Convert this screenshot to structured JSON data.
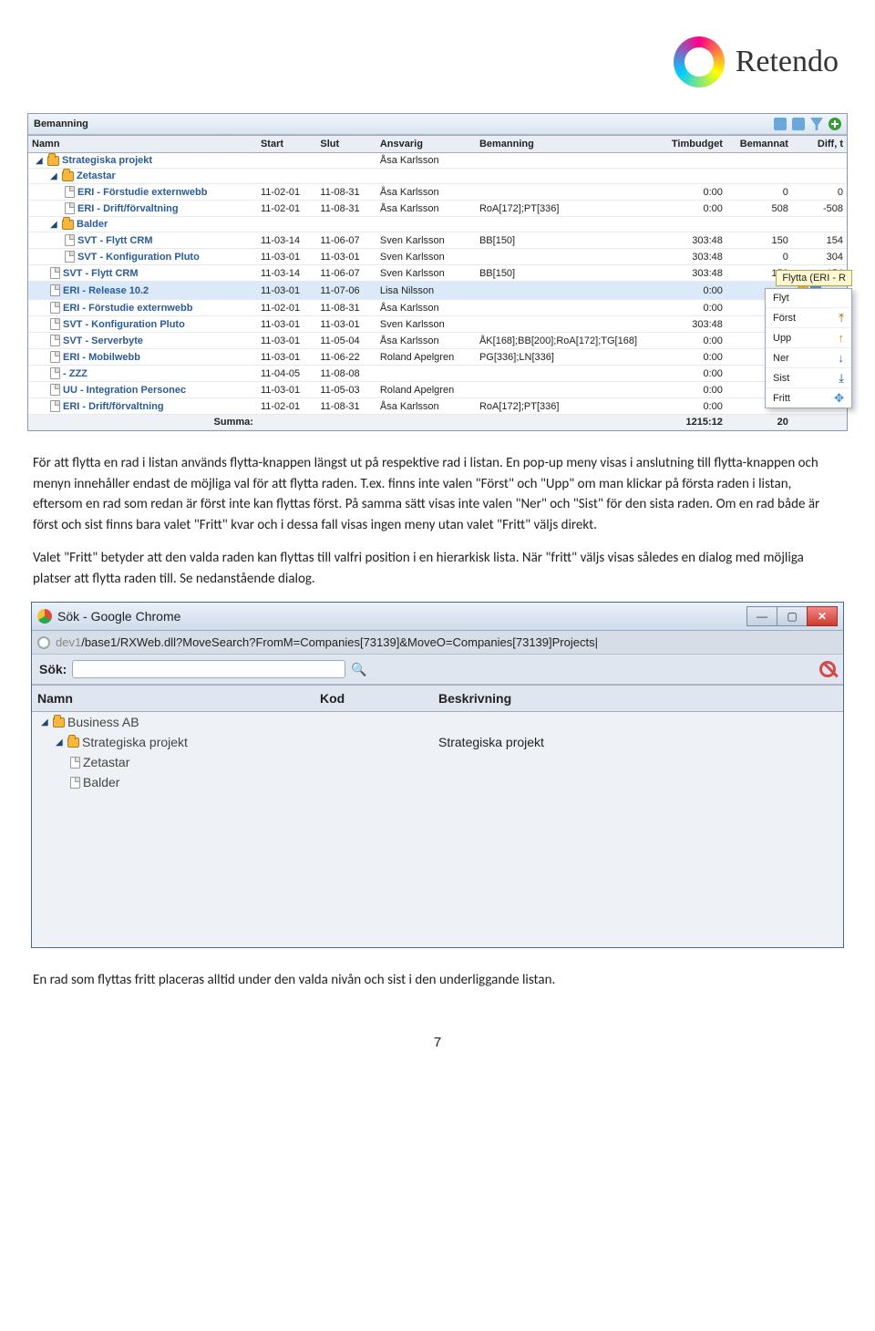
{
  "brand": "Retendo",
  "panel": {
    "title": "Bemanning",
    "headers": [
      "Namn",
      "Start",
      "Slut",
      "Ansvarig",
      "Bemanning",
      "Timbudget",
      "Bemannat",
      "Diff, t"
    ],
    "summa_label": "Summa:"
  },
  "rows": [
    {
      "depth": 0,
      "exp": true,
      "icon": "folder",
      "name": "Strategiska projekt",
      "start": "",
      "slut": "",
      "ansvarig": "Åsa Karlsson",
      "bem": "",
      "bud": "",
      "man": "",
      "diff": "",
      "selected": false
    },
    {
      "depth": 1,
      "exp": true,
      "icon": "folder",
      "name": "Zetastar",
      "start": "",
      "slut": "",
      "ansvarig": "",
      "bem": "",
      "bud": "",
      "man": "",
      "diff": "",
      "selected": false
    },
    {
      "depth": 2,
      "exp": false,
      "icon": "doc",
      "name": "ERI - Förstudie externwebb",
      "start": "11-02-01",
      "slut": "11-08-31",
      "ansvarig": "Åsa Karlsson",
      "bem": "",
      "bud": "0:00",
      "man": "0",
      "diff": "0",
      "selected": false
    },
    {
      "depth": 2,
      "exp": false,
      "icon": "doc",
      "name": "ERI - Drift/förvaltning",
      "start": "11-02-01",
      "slut": "11-08-31",
      "ansvarig": "Åsa Karlsson",
      "bem": "RoA[172];PT[336]",
      "bud": "0:00",
      "man": "508",
      "diff": "-508",
      "selected": false
    },
    {
      "depth": 1,
      "exp": true,
      "icon": "folder",
      "name": "Balder",
      "start": "",
      "slut": "",
      "ansvarig": "",
      "bem": "",
      "bud": "",
      "man": "",
      "diff": "",
      "selected": false
    },
    {
      "depth": 2,
      "exp": false,
      "icon": "doc",
      "name": "SVT - Flytt CRM",
      "start": "11-03-14",
      "slut": "11-06-07",
      "ansvarig": "Sven Karlsson",
      "bem": "BB[150]",
      "bud": "303:48",
      "man": "150",
      "diff": "154",
      "selected": false
    },
    {
      "depth": 2,
      "exp": false,
      "icon": "doc",
      "name": "SVT - Konfiguration Pluto",
      "start": "11-03-01",
      "slut": "11-03-01",
      "ansvarig": "Sven Karlsson",
      "bem": "",
      "bud": "303:48",
      "man": "0",
      "diff": "304",
      "selected": false
    },
    {
      "depth": 1,
      "exp": false,
      "icon": "doc",
      "name": "SVT - Flytt CRM",
      "start": "11-03-14",
      "slut": "11-06-07",
      "ansvarig": "Sven Karlsson",
      "bem": "BB[150]",
      "bud": "303:48",
      "man": "150",
      "diff": "154",
      "selected": false
    },
    {
      "depth": 1,
      "exp": false,
      "icon": "doc",
      "name": "ERI - Release 10.2",
      "start": "11-03-01",
      "slut": "11-07-06",
      "ansvarig": "Lisa Nilsson",
      "bem": "",
      "bud": "0:00",
      "man": "",
      "diff": "",
      "selected": true
    },
    {
      "depth": 1,
      "exp": false,
      "icon": "doc",
      "name": "ERI - Förstudie externwebb",
      "start": "11-02-01",
      "slut": "11-08-31",
      "ansvarig": "Åsa Karlsson",
      "bem": "",
      "bud": "0:00",
      "man": "",
      "diff": "",
      "selected": false
    },
    {
      "depth": 1,
      "exp": false,
      "icon": "doc",
      "name": "SVT - Konfiguration Pluto",
      "start": "11-03-01",
      "slut": "11-03-01",
      "ansvarig": "Sven Karlsson",
      "bem": "",
      "bud": "303:48",
      "man": "",
      "diff": "",
      "selected": false
    },
    {
      "depth": 1,
      "exp": false,
      "icon": "doc",
      "name": "SVT - Serverbyte",
      "start": "11-03-01",
      "slut": "11-05-04",
      "ansvarig": "Åsa Karlsson",
      "bem": "ÅK[168];BB[200];RoA[172];TG[168]",
      "bud": "0:00",
      "man": "",
      "diff": "",
      "selected": false
    },
    {
      "depth": 1,
      "exp": false,
      "icon": "doc",
      "name": "ERI - Mobilwebb",
      "start": "11-03-01",
      "slut": "11-06-22",
      "ansvarig": "Roland Apelgren",
      "bem": "PG[336];LN[336]",
      "bud": "0:00",
      "man": "",
      "diff": "",
      "selected": false
    },
    {
      "depth": 1,
      "exp": false,
      "icon": "doc",
      "name": "- ZZZ",
      "start": "11-04-05",
      "slut": "11-08-08",
      "ansvarig": "",
      "bem": "",
      "bud": "0:00",
      "man": "",
      "diff": "",
      "selected": false
    },
    {
      "depth": 1,
      "exp": false,
      "icon": "doc",
      "name": "UU - Integration Personec",
      "start": "11-03-01",
      "slut": "11-05-03",
      "ansvarig": "Roland Apelgren",
      "bem": "",
      "bud": "0:00",
      "man": "",
      "diff": "",
      "selected": false
    },
    {
      "depth": 1,
      "exp": false,
      "icon": "doc",
      "name": "ERI - Drift/förvaltning",
      "start": "11-02-01",
      "slut": "11-08-31",
      "ansvarig": "Åsa Karlsson",
      "bem": "RoA[172];PT[336]",
      "bud": "0:00",
      "man": "",
      "diff": "",
      "selected": false
    }
  ],
  "summa": {
    "bud": "1215:12",
    "man": "20"
  },
  "popup": {
    "tooltip": "Flytta (ERI - R",
    "items": [
      {
        "label": "Flyt",
        "arrow": "",
        "cls": ""
      },
      {
        "label": "Först",
        "arrow": "⤒",
        "cls": "arr-top"
      },
      {
        "label": "Upp",
        "arrow": "↑",
        "cls": "arr-up"
      },
      {
        "label": "Ner",
        "arrow": "↓",
        "cls": "arr-down"
      },
      {
        "label": "Sist",
        "arrow": "⤓",
        "cls": "arr-bot"
      },
      {
        "label": "Fritt",
        "arrow": "✥",
        "cls": "arr-free"
      }
    ]
  },
  "prose": {
    "p1": "För att flytta en rad i listan används flytta-knappen längst ut på respektive rad i listan. En pop-up meny visas i anslutning till flytta-knappen och menyn innehåller endast de möjliga val för att flytta raden. T.ex. finns inte valen \"Först\" och \"Upp\" om man klickar på första raden i listan, eftersom en rad som redan är först inte kan flyttas först. På samma sätt visas inte valen \"Ner\" och \"Sist\" för den sista raden. Om en rad både är först och sist finns bara valet \"Fritt\" kvar och i dessa fall visas ingen meny utan valet \"Fritt\" väljs direkt.",
    "p2": "Valet \"Fritt\" betyder att den valda raden kan flyttas till valfri position i en hierarkisk lista. När \"fritt\" väljs visas således en dialog med möjliga platser att flytta raden till. Se nedanstående dialog.",
    "p3": "En rad som flyttas fritt placeras alltid under den valda nivån och sist i den underliggande listan."
  },
  "chrome": {
    "title": "Sök - Google Chrome",
    "url_dim": "dev1",
    "url_rest": "/base1/RXWeb.dll?MoveSearch?FromM=Companies[73139]&MoveO=Companies[73139]Projects|",
    "search_label": "Sök:",
    "headers": [
      "Namn",
      "Kod",
      "Beskrivning"
    ],
    "rows": [
      {
        "depth": 0,
        "exp": true,
        "icon": "folder",
        "name": "Business AB",
        "kod": "",
        "besk": ""
      },
      {
        "depth": 1,
        "exp": true,
        "icon": "folder",
        "name": "Strategiska projekt",
        "kod": "",
        "besk": "Strategiska projekt"
      },
      {
        "depth": 2,
        "exp": false,
        "icon": "doc",
        "name": "Zetastar",
        "kod": "",
        "besk": ""
      },
      {
        "depth": 2,
        "exp": false,
        "icon": "doc",
        "name": "Balder",
        "kod": "",
        "besk": ""
      }
    ]
  },
  "page_number": "7"
}
